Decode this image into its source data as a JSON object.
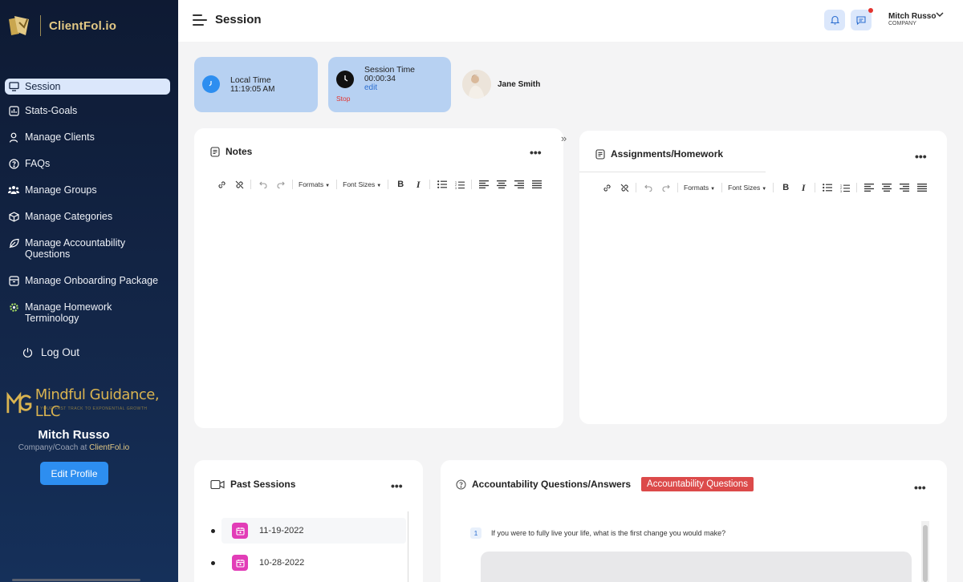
{
  "brand": {
    "name": "ClientFol.io"
  },
  "sidebar": {
    "items": [
      {
        "label": "Session",
        "icon": "monitor-icon",
        "active": true
      },
      {
        "label": "Stats-Goals",
        "icon": "chart-icon"
      },
      {
        "label": "Manage Clients",
        "icon": "user-icon"
      },
      {
        "label": "FAQs",
        "icon": "help-circle-icon"
      },
      {
        "label": "Manage Groups",
        "icon": "group-icon"
      },
      {
        "label": "Manage Categories",
        "icon": "cube-icon"
      },
      {
        "label": "Manage Accountability Questions",
        "icon": "leaf-icon"
      },
      {
        "label": "Manage Onboarding Package",
        "icon": "archive-icon"
      },
      {
        "label": "Manage Homework Terminology",
        "icon": "gear-icon"
      }
    ],
    "logout_label": "Log Out",
    "company_logo_text": "Mindful Guidance, LLC",
    "company_tagline": "YOUR FAST TRACK TO EXPONENTIAL GROWTH",
    "profile_name": "Mitch Russo",
    "profile_role": "Company/Coach at",
    "profile_role_brand": "ClientFol.io",
    "edit_profile_label": "Edit Profile"
  },
  "header": {
    "title": "Session",
    "user_name": "Mitch Russo",
    "user_company": "COMPANY"
  },
  "timers": {
    "local_label": "Local Time",
    "local_value": "11:19:05 AM",
    "session_label": "Session Time",
    "session_value": "00:00:34",
    "edit_label": "edit",
    "stop_label": "Stop"
  },
  "client": {
    "name": "Jane Smith"
  },
  "notes": {
    "title": "Notes"
  },
  "assignments": {
    "title": "Assignments/Homework"
  },
  "editor_toolbar": {
    "formats_label": "Formats",
    "font_sizes_label": "Font Sizes"
  },
  "past_sessions": {
    "title": "Past Sessions",
    "dates": [
      "11-19-2022",
      "10-28-2022"
    ]
  },
  "accountability": {
    "title": "Accountability Questions/Answers",
    "tag": "Accountability Questions",
    "question_number": "1",
    "question_text": "If you were to fully live your life, what is the first change you would make?"
  },
  "colors": {
    "sidebar_bg": "#132648",
    "active_nav_bg": "#dbe7fb",
    "timer_card_bg": "#b7d1f2",
    "primary_button": "#2d8ef0",
    "accent_red": "#dc4a4a",
    "calendar_pink": "#e23db7",
    "brand_gold": "#e3c985"
  }
}
